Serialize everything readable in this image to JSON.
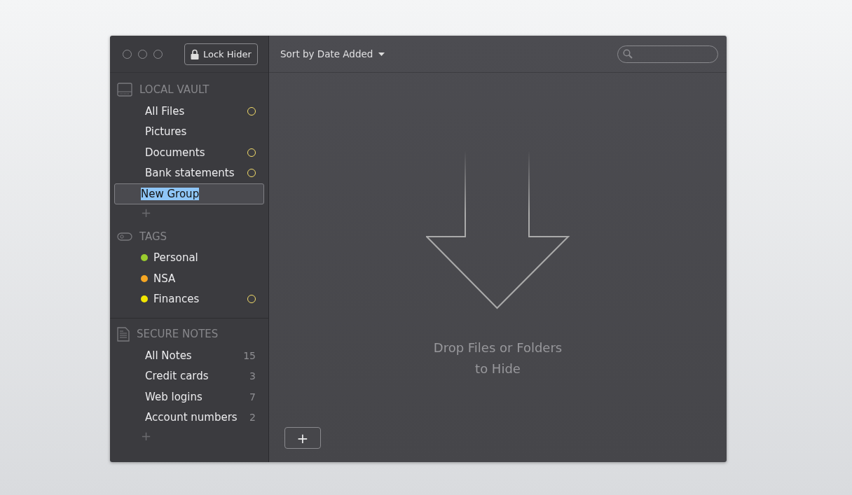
{
  "window": {
    "lock_button": "Lock Hider"
  },
  "toolbar": {
    "sort": "Sort by Date Added"
  },
  "sidebar": {
    "vault": {
      "title": "LOCAL VAULT",
      "items": [
        {
          "label": "All Files",
          "selected": false,
          "badge": true
        },
        {
          "label": "Pictures",
          "selected": false,
          "badge": false
        },
        {
          "label": "Documents",
          "selected": false,
          "badge": true
        },
        {
          "label": "Bank statements",
          "selected": false,
          "badge": true
        },
        {
          "label": "New Group",
          "selected": true,
          "badge": false
        }
      ],
      "add": "+"
    },
    "tags": {
      "title": "TAGS",
      "items": [
        {
          "label": "Personal",
          "color": "#9acd2e",
          "badge": false
        },
        {
          "label": "NSA",
          "color": "#f5a623",
          "badge": false
        },
        {
          "label": "Finances",
          "color": "#f2e600",
          "badge": true
        }
      ]
    },
    "notes": {
      "title": "SECURE NOTES",
      "items": [
        {
          "label": "All Notes",
          "count": "15"
        },
        {
          "label": "Credit cards",
          "count": "3"
        },
        {
          "label": "Web logins",
          "count": "7"
        },
        {
          "label": "Account numbers",
          "count": "2"
        }
      ],
      "add": "+"
    }
  },
  "drop_zone": {
    "lines": [
      "Drop Files or Folders",
      "to Hide"
    ]
  },
  "add_button": "+"
}
